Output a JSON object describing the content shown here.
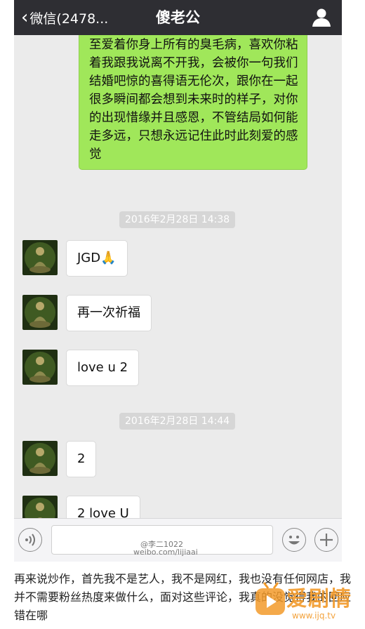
{
  "navbar": {
    "back_label": "微信(2478...",
    "title": "傻老公"
  },
  "messages": {
    "outgoing_text": "至爱着你身上所有的臭毛病，喜欢你粘着我跟我说离不开我，会被你一句我们结婚吧惊的喜得语无伦次，跟你在一起很多瞬间都会想到未来时的样子，对你的出现惜缘并且感恩，不管结局如何能走多远，只想永远记住此时此刻爱的感觉",
    "timestamp_1": "2016年2月28日 14:38",
    "msg_1": "JGD🙏",
    "msg_2": "再一次祈福",
    "msg_3": "love u 2",
    "timestamp_2": "2016年2月28日 14:44",
    "msg_4": "2",
    "msg_5": "2 love U"
  },
  "watermark": {
    "line1": "@李二1022",
    "line2": "weibo.com/lijiaai"
  },
  "article": {
    "text": "再来说炒作，首先我不是艺人，我不是网红，我也没有任何网店，我并不需要粉丝热度来做什么，面对这些评论，我真的没觉得我的回应错在哪"
  },
  "logo": {
    "name": "爱剧情",
    "url": "www.ijq.tv"
  },
  "icons": [
    "chevron-left-icon",
    "person-icon",
    "voice-icon",
    "emoji-icon",
    "plus-icon"
  ],
  "colors": {
    "navbar": "#2e2e33",
    "outgoing_bubble": "#a0e75a",
    "chat_bg": "#ebebeb",
    "logo": "#f29a2a"
  }
}
